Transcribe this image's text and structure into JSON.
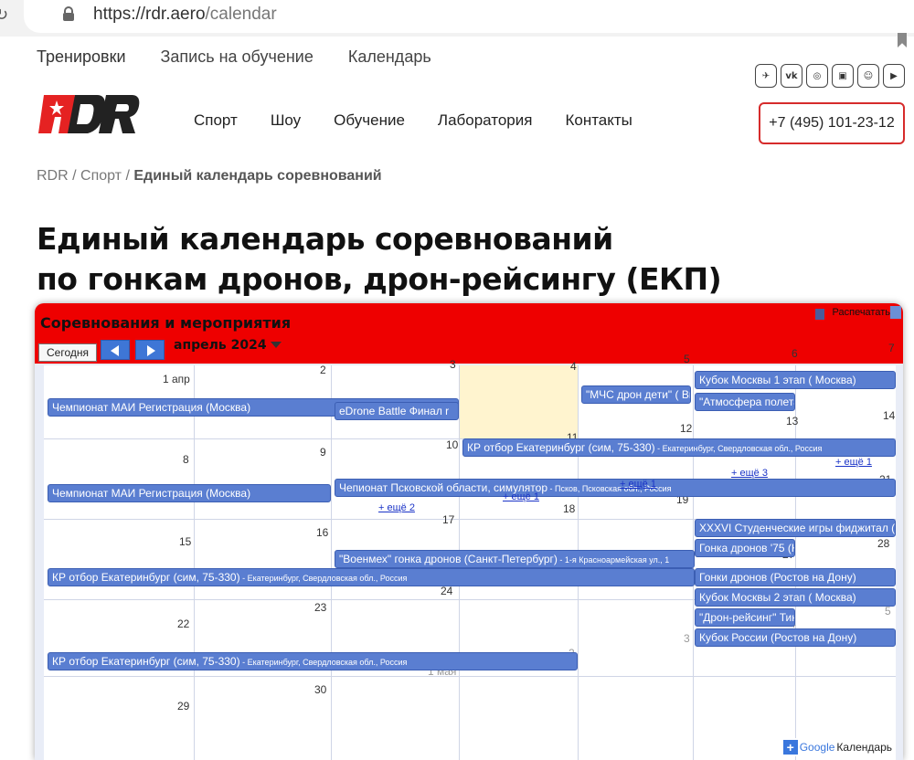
{
  "browser": {
    "url_host": "https://rdr.aero",
    "url_path": "/calendar"
  },
  "topnav": [
    "Тренировки",
    "Запись на обучение",
    "Календарь"
  ],
  "social": [
    "telegram-icon",
    "vk-icon",
    "odnoklassniki-icon",
    "twitch-icon",
    "discord-icon",
    "youtube-icon"
  ],
  "logo_text": "RDR",
  "mainnav": [
    "Спорт",
    "Шоу",
    "Обучение",
    "Лаборатория",
    "Контакты"
  ],
  "phone": "+7 (495) 101-23-12",
  "breadcrumb": {
    "root": "RDR",
    "sep1": " / ",
    "section": "Спорт",
    "sep2": " / ",
    "current": "Единый календарь соревнований"
  },
  "title_line1": "Единый календарь соревнований",
  "title_line2": "по гонкам дронов, дрон-рейсингу (ЕКП)",
  "calendar": {
    "title": "Соревнования и мероприятия",
    "print": "Распечатать",
    "today": "Сегодня",
    "month": "апрель 2024",
    "weekdays": [
      "Пн",
      "Вт",
      "Ср",
      "Чт",
      "Пт",
      "Сб",
      "Вс"
    ],
    "weeks": [
      [
        "1 апр",
        "2",
        "3",
        "4",
        "5",
        "6",
        "7"
      ],
      [
        "8",
        "9",
        "10",
        "11",
        "12",
        "13",
        "14"
      ],
      [
        "15",
        "16",
        "17",
        "18",
        "19",
        "20",
        "21"
      ],
      [
        "22",
        "23",
        "24",
        "25",
        "26",
        "27",
        "28"
      ],
      [
        "29",
        "30",
        "1 мая",
        "2",
        "3",
        "4",
        "5"
      ]
    ],
    "events": {
      "e1": "Чемпионат МАИ Регистрация (Москва)",
      "e2": "eDrone Battle Финал r",
      "e3": "\"МЧС дрон дети\" ( Ви",
      "e4": "Кубок Москвы 1 этап ( Москва)",
      "e5": "\"Атмосфера полета 20",
      "e6": "КР отбор Екатеринбург (сим, 75-330)",
      "e6loc": " - Екатеринбург, Свердловская обл., Россия",
      "e7": "Чемпионат МАИ Регистрация (Москва)",
      "e8": "Чепионат Псковской области, симулятор",
      "e8loc": " - Псков, Псковская обл., Россия",
      "e9": "XXXVI Студенческие игры фиджитал ( Моск",
      "e10": "Гонка дронов '75 (Ке",
      "e11": "КР отбор Екатеринбург (сим, 75-330)",
      "e11loc": " - Екатеринбург, Свердловская обл., Россия",
      "e12": "\"Военмех\" гонка дронов (Санкт-Петербург)",
      "e12loc": " - 1-я Красноармейская ул., 1",
      "e13": "Гонки дронов (Ростов на Дону)",
      "e14": "Кубок Москвы 2 этап ( Москва)",
      "e15": "\"Дрон-рейсинг\" Тини",
      "e16": "КР отбор Екатеринбург (сим, 75-330)",
      "e16loc": " - Екатеринбург, Свердловская обл., Россия",
      "e17": "Кубок России (Ростов на Дону)"
    },
    "more": {
      "m1": "+ ещё 2",
      "m2": "+ ещё 1",
      "m3": "+ ещё 1",
      "m4": "+ ещё 3",
      "m5": "+ ещё 1"
    },
    "google": "Календарь",
    "google_plus": "+",
    "google_logo": "Google"
  },
  "colors": {
    "accent_red": "#ee0000",
    "event_blue": "#5a7ed1",
    "phone_border": "#d62b2b"
  }
}
